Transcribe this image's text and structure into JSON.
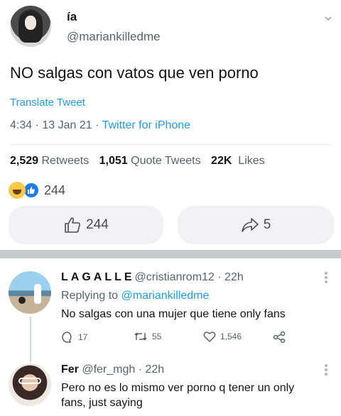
{
  "tweet": {
    "name": "ía",
    "handle": "@mariankilledme",
    "text": "NO salgas con vatos que ven porno",
    "translate": "Translate Tweet",
    "time": "4:34 · 13 Jan 21 · ",
    "source": "Twitter for iPhone",
    "stats": {
      "retweets_count": "2,529",
      "retweets_label": "Retweets",
      "quotes_count": "1,051",
      "quotes_label": "Quote Tweets",
      "likes_count": "22K",
      "likes_label": "Likes"
    }
  },
  "reactions": {
    "count": "244",
    "like_button_count": "244",
    "share_button_count": "5"
  },
  "replies": [
    {
      "name": "LAGALLE",
      "handle_time": "@cristianrom12 · 22h",
      "replying_prefix": "Replying to",
      "replying_to": "@mariankilledme",
      "text": "No salgas con una mujer que tiene only fans",
      "reply_count": "17",
      "retweet_count": "55",
      "like_count": "1,546"
    },
    {
      "name": "Fer ",
      "handle_time": "@fer_mgh · 22h",
      "text_line1": "Pero no es lo mismo ver porno q tener un only",
      "text_line2": "fans, just saying"
    }
  ]
}
